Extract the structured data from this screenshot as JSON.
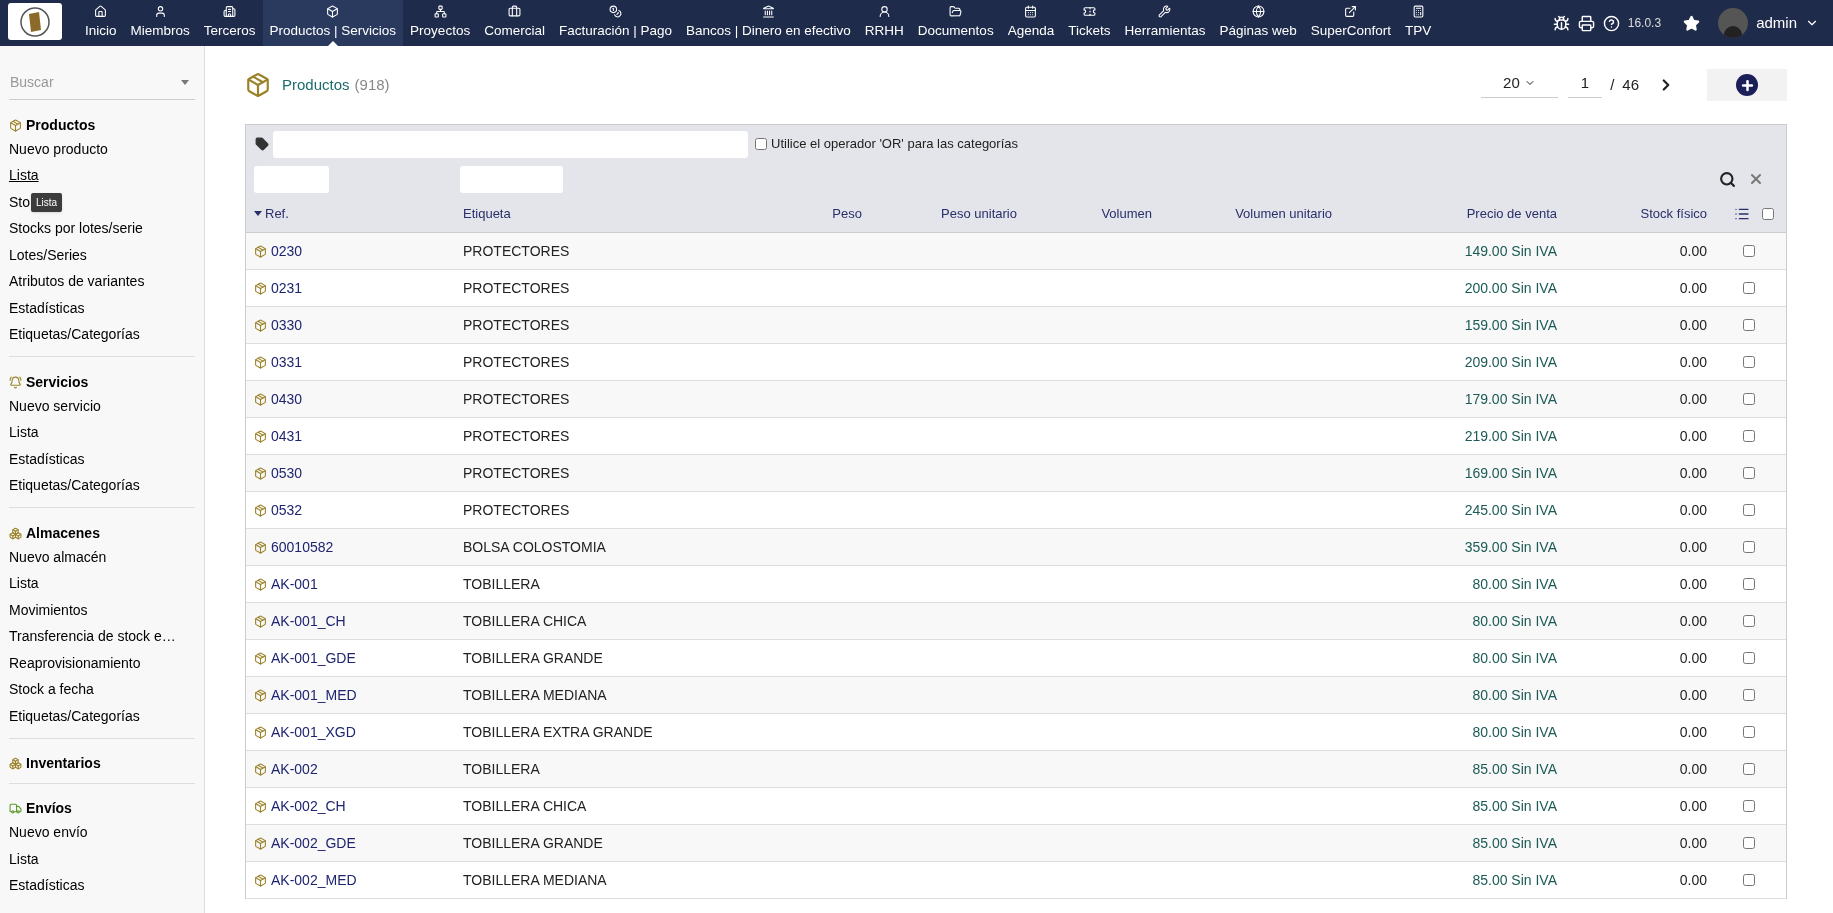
{
  "top_menu": {
    "items": [
      {
        "label": "Inicio",
        "selected": false
      },
      {
        "label": "Miembros",
        "selected": false
      },
      {
        "label": "Terceros",
        "selected": false
      },
      {
        "label": "Productos | Servicios",
        "selected": true
      },
      {
        "label": "Proyectos",
        "selected": false
      },
      {
        "label": "Comercial",
        "selected": false
      },
      {
        "label": "Facturación | Pago",
        "selected": false
      },
      {
        "label": "Bancos | Dinero en efectivo",
        "selected": false
      },
      {
        "label": "RRHH",
        "selected": false
      },
      {
        "label": "Documentos",
        "selected": false
      },
      {
        "label": "Agenda",
        "selected": false
      },
      {
        "label": "Tickets",
        "selected": false
      },
      {
        "label": "Herramientas",
        "selected": false
      },
      {
        "label": "Páginas web",
        "selected": false
      },
      {
        "label": "SuperConfort",
        "selected": false
      },
      {
        "label": "TPV",
        "selected": false
      }
    ],
    "version": "16.0.3",
    "user": "admin"
  },
  "sidebar": {
    "search": {
      "placeholder": "Buscar"
    },
    "sections": [
      {
        "title": "Productos",
        "items": [
          {
            "label": "Nuevo producto",
            "hovered": false
          },
          {
            "label": "Lista",
            "hovered": true
          },
          {
            "label": "Sto",
            "hovered": false,
            "tooltip": "Lista"
          },
          {
            "label": "Stocks por lotes/serie",
            "hovered": false
          },
          {
            "label": "Lotes/Series",
            "hovered": false
          },
          {
            "label": "Atributos de variantes",
            "hovered": false
          },
          {
            "label": "Estadísticas",
            "hovered": false
          },
          {
            "label": "Etiquetas/Categorías",
            "hovered": false
          }
        ]
      },
      {
        "title": "Servicios",
        "items": [
          {
            "label": "Nuevo servicio",
            "hovered": false
          },
          {
            "label": "Lista",
            "hovered": false
          },
          {
            "label": "Estadísticas",
            "hovered": false
          },
          {
            "label": "Etiquetas/Categorías",
            "hovered": false
          }
        ]
      },
      {
        "title": "Almacenes",
        "items": [
          {
            "label": "Nuevo almacén",
            "hovered": false
          },
          {
            "label": "Lista",
            "hovered": false
          },
          {
            "label": "Movimientos",
            "hovered": false
          },
          {
            "label": "Transferencia de stock e…",
            "hovered": false
          },
          {
            "label": "Reaprovisionamiento",
            "hovered": false
          },
          {
            "label": "Stock a fecha",
            "hovered": false
          },
          {
            "label": "Etiquetas/Categorías",
            "hovered": false
          }
        ]
      },
      {
        "title": "Inventarios"
      },
      {
        "title": "Envíos",
        "items": [
          {
            "label": "Nuevo envío",
            "hovered": false
          },
          {
            "label": "Lista",
            "hovered": false
          },
          {
            "label": "Estadísticas",
            "hovered": false
          }
        ]
      }
    ]
  },
  "page": {
    "title": "Productos",
    "count": "(918)",
    "pagination": {
      "per_page": "20",
      "page": "1",
      "separator": "/",
      "pages": "46"
    }
  },
  "filters": {
    "or_operator": {
      "label": "Utilice el operador 'OR' para las categorías",
      "checked": false
    }
  },
  "table": {
    "columns": [
      {
        "label": "Ref.",
        "sorted": true
      },
      {
        "label": "Etiqueta",
        "sorted": false
      },
      {
        "label": "Peso",
        "sorted": false
      },
      {
        "label": "Peso unitario",
        "sorted": false
      },
      {
        "label": "Volumen",
        "sorted": false
      },
      {
        "label": "Volumen unitario",
        "sorted": false
      },
      {
        "label": "Precio de venta",
        "sorted": false
      },
      {
        "label": "Stock físico",
        "sorted": false
      }
    ],
    "select_all": false,
    "rows": [
      {
        "ref": "0230",
        "label": "PROTECTORES",
        "price": "149.00 Sin IVA",
        "stock": "0.00",
        "checked": false
      },
      {
        "ref": "0231",
        "label": "PROTECTORES",
        "price": "200.00 Sin IVA",
        "stock": "0.00",
        "checked": false
      },
      {
        "ref": "0330",
        "label": "PROTECTORES",
        "price": "159.00 Sin IVA",
        "stock": "0.00",
        "checked": false
      },
      {
        "ref": "0331",
        "label": "PROTECTORES",
        "price": "209.00 Sin IVA",
        "stock": "0.00",
        "checked": false
      },
      {
        "ref": "0430",
        "label": "PROTECTORES",
        "price": "179.00 Sin IVA",
        "stock": "0.00",
        "checked": false
      },
      {
        "ref": "0431",
        "label": "PROTECTORES",
        "price": "219.00 Sin IVA",
        "stock": "0.00",
        "checked": false
      },
      {
        "ref": "0530",
        "label": "PROTECTORES",
        "price": "169.00 Sin IVA",
        "stock": "0.00",
        "checked": false
      },
      {
        "ref": "0532",
        "label": "PROTECTORES",
        "price": "245.00 Sin IVA",
        "stock": "0.00",
        "checked": false
      },
      {
        "ref": "60010582",
        "label": "BOLSA COLOSTOMIA",
        "price": "359.00 Sin IVA",
        "stock": "0.00",
        "checked": false
      },
      {
        "ref": "AK-001",
        "label": "TOBILLERA",
        "price": "80.00 Sin IVA",
        "stock": "0.00",
        "checked": false
      },
      {
        "ref": "AK-001_CH",
        "label": "TOBILLERA CHICA",
        "price": "80.00 Sin IVA",
        "stock": "0.00",
        "checked": false
      },
      {
        "ref": "AK-001_GDE",
        "label": "TOBILLERA GRANDE",
        "price": "80.00 Sin IVA",
        "stock": "0.00",
        "checked": false
      },
      {
        "ref": "AK-001_MED",
        "label": "TOBILLERA MEDIANA",
        "price": "80.00 Sin IVA",
        "stock": "0.00",
        "checked": false
      },
      {
        "ref": "AK-001_XGD",
        "label": "TOBILLERA EXTRA GRANDE",
        "price": "80.00 Sin IVA",
        "stock": "0.00",
        "checked": false
      },
      {
        "ref": "AK-002",
        "label": "TOBILLERA",
        "price": "85.00 Sin IVA",
        "stock": "0.00",
        "checked": false
      },
      {
        "ref": "AK-002_CH",
        "label": "TOBILLERA CHICA",
        "price": "85.00 Sin IVA",
        "stock": "0.00",
        "checked": false
      },
      {
        "ref": "AK-002_GDE",
        "label": "TOBILLERA GRANDE",
        "price": "85.00 Sin IVA",
        "stock": "0.00",
        "checked": false
      },
      {
        "ref": "AK-002_MED",
        "label": "TOBILLERA MEDIANA",
        "price": "85.00 Sin IVA",
        "stock": "0.00",
        "checked": false
      }
    ]
  }
}
